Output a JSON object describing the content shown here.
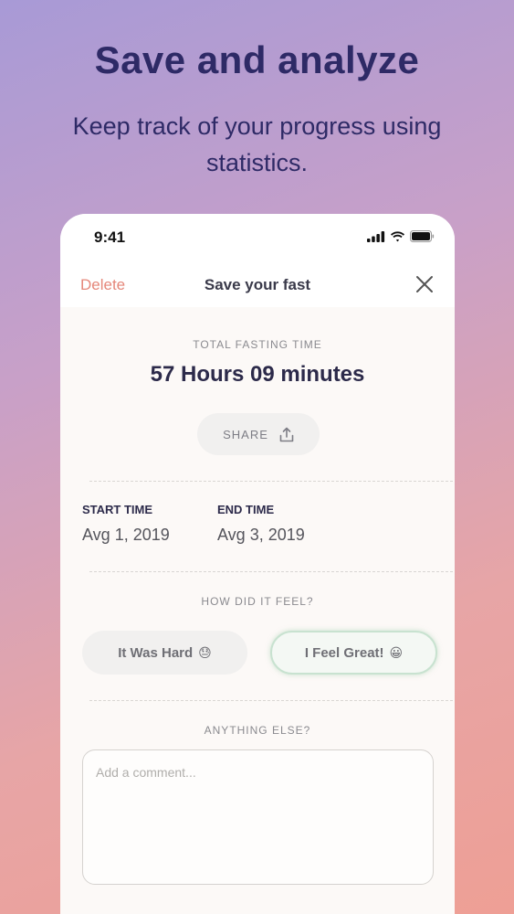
{
  "hero": {
    "title": "Save and analyze",
    "subtitle": "Keep track of your progress using statistics."
  },
  "status_bar": {
    "time": "9:41"
  },
  "navbar": {
    "delete_label": "Delete",
    "title": "Save your fast"
  },
  "fast": {
    "total_label": "TOTAL FASTING TIME",
    "total_value": "57 Hours 09 minutes",
    "share_label": "SHARE",
    "start_label": "START TIME",
    "start_value": "Avg 1, 2019",
    "end_label": "END TIME",
    "end_value": "Avg 3, 2019"
  },
  "feeling": {
    "question": "HOW DID IT FEEL?",
    "options": [
      {
        "label": "It Was Hard",
        "emoji": "😓"
      },
      {
        "label": "I Feel Great!",
        "emoji": "😀"
      }
    ]
  },
  "comment": {
    "question": "ANYTHING ELSE?",
    "placeholder": "Add a comment..."
  },
  "colors": {
    "accent": "#e5877a",
    "title": "#2e2a66"
  }
}
